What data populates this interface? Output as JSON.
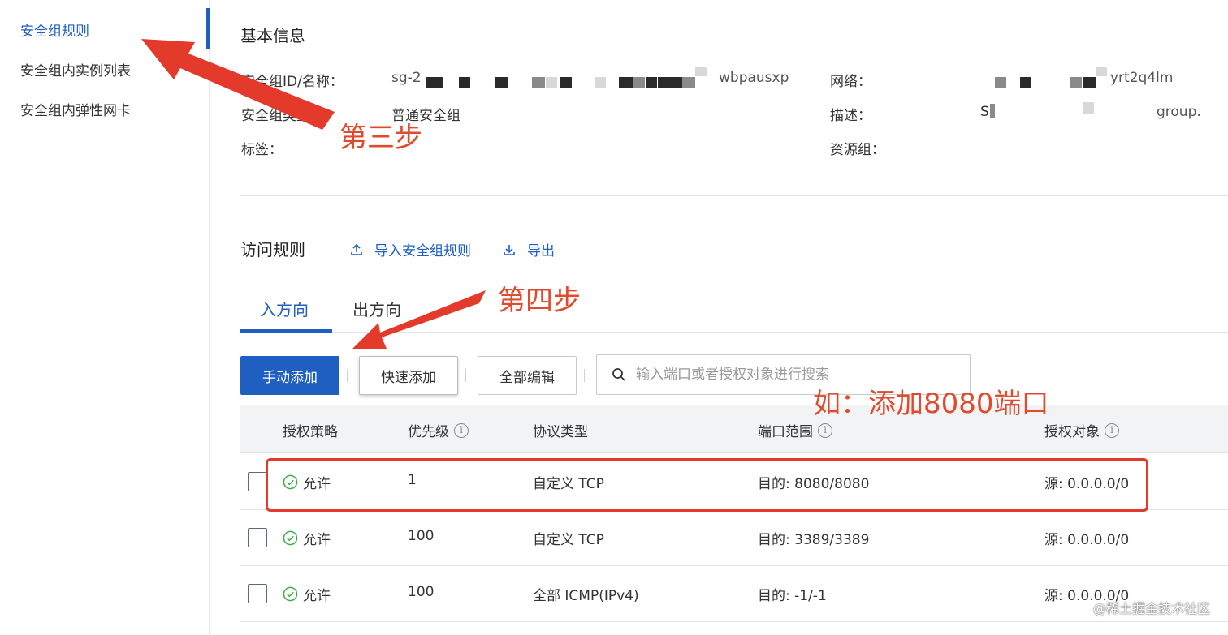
{
  "sidebar": {
    "items": [
      {
        "label": "安全组规则",
        "active": true
      },
      {
        "label": "安全组内实例列表",
        "active": false
      },
      {
        "label": "安全组内弹性网卡",
        "active": false
      }
    ]
  },
  "basic_info": {
    "title": "基本信息",
    "fields": {
      "id_name_label": "安全组ID/名称：",
      "id_name_prefix": "sg-2",
      "id_name_suffix": "wbpausxp",
      "type_label": "安全组类型：",
      "type_value": "普通安全组",
      "tags_label": "标签：",
      "network_label": "网络：",
      "network_suffix": "yrt2q4lm",
      "desc_label": "描述：",
      "desc_prefix": "S",
      "desc_suffix": "group.",
      "resource_group_label": "资源组："
    }
  },
  "access_rules": {
    "title": "访问规则",
    "import_label": "导入安全组规则",
    "export_label": "导出"
  },
  "tabs": [
    {
      "label": "入方向",
      "active": true
    },
    {
      "label": "出方向",
      "active": false
    }
  ],
  "toolbar": {
    "manual_add": "手动添加",
    "quick_add": "快速添加",
    "edit_all": "全部编辑",
    "search_placeholder": "输入端口或者授权对象进行搜索"
  },
  "table": {
    "headers": {
      "policy": "授权策略",
      "priority": "优先级",
      "protocol": "协议类型",
      "port_range": "端口范围",
      "auth_object": "授权对象"
    },
    "rows": [
      {
        "policy": "允许",
        "priority": "1",
        "protocol": "自定义 TCP",
        "port": "目的: 8080/8080",
        "object": "源: 0.0.0.0/0"
      },
      {
        "policy": "允许",
        "priority": "100",
        "protocol": "自定义 TCP",
        "port": "目的: 3389/3389",
        "object": "源: 0.0.0.0/0"
      },
      {
        "policy": "允许",
        "priority": "100",
        "protocol": "全部 ICMP(IPv4)",
        "port": "目的: -1/-1",
        "object": "源: 0.0.0.0/0"
      }
    ]
  },
  "annotations": {
    "step3": "第三步",
    "step4": "第四步",
    "example": "如：添加8080端口"
  },
  "watermark": "@稀土掘金技术社区",
  "colors": {
    "accent": "#1f5fc2",
    "annotation": "#e14a2d",
    "success": "#3fae49"
  }
}
